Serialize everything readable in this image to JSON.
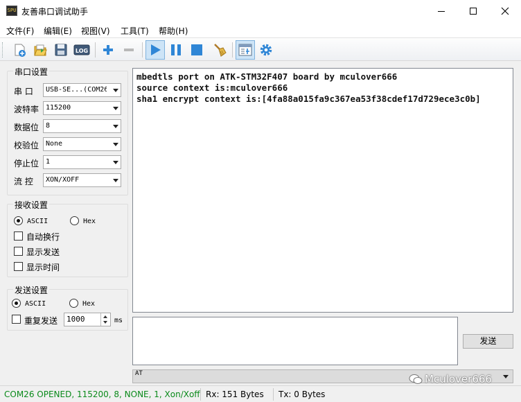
{
  "window": {
    "title": "友善串口调试助手",
    "app_icon_text": "SPU"
  },
  "menu": {
    "items": [
      "文件(F)",
      "编辑(E)",
      "视图(V)",
      "工具(T)",
      "帮助(H)"
    ]
  },
  "toolbar": {
    "icons": [
      "new-session-icon",
      "open-folder-icon",
      "save-icon",
      "log-icon",
      "add-icon",
      "remove-icon",
      "play-icon",
      "pause-icon",
      "stop-icon",
      "clear-broom-icon",
      "panel-layout-icon",
      "settings-gear-icon"
    ],
    "log_text": "LOG"
  },
  "serial_settings": {
    "title": "串口设置",
    "port": {
      "label": "串  口",
      "value": "USB-SE...(COM26"
    },
    "baud": {
      "label": "波特率",
      "value": "115200"
    },
    "data_bits": {
      "label": "数据位",
      "value": "8"
    },
    "parity": {
      "label": "校验位",
      "value": "None"
    },
    "stop_bits": {
      "label": "停止位",
      "value": "1"
    },
    "flow": {
      "label": "流  控",
      "value": "XON/XOFF"
    }
  },
  "receive_settings": {
    "title": "接收设置",
    "ascii_label": "ASCII",
    "hex_label": "Hex",
    "mode": "ASCII",
    "auto_wrap": {
      "label": "自动换行",
      "checked": false
    },
    "show_send": {
      "label": "显示发送",
      "checked": false
    },
    "show_time": {
      "label": "显示时间",
      "checked": false
    }
  },
  "send_settings": {
    "title": "发送设置",
    "ascii_label": "ASCII",
    "hex_label": "Hex",
    "mode": "ASCII",
    "repeat": {
      "label": "重复发送",
      "checked": false
    },
    "interval": "1000",
    "unit": "ms"
  },
  "receive_output": [
    "mbedtls port on ATK-STM32F407 board by mculover666",
    "source context is:mculover666",
    "sha1 encrypt context is:[4fa88a015fa9c367ea53f38cdef17d729ece3c0b]"
  ],
  "send_button": "发送",
  "command_combo_value": "AT",
  "watermark": "Mculover666",
  "status": {
    "connection": "COM26 OPENED, 115200, 8, NONE, 1, Xon/Xoff",
    "rx": "Rx: 151 Bytes",
    "tx": "Tx: 0 Bytes",
    "connection_color": "#0a8a1a"
  }
}
